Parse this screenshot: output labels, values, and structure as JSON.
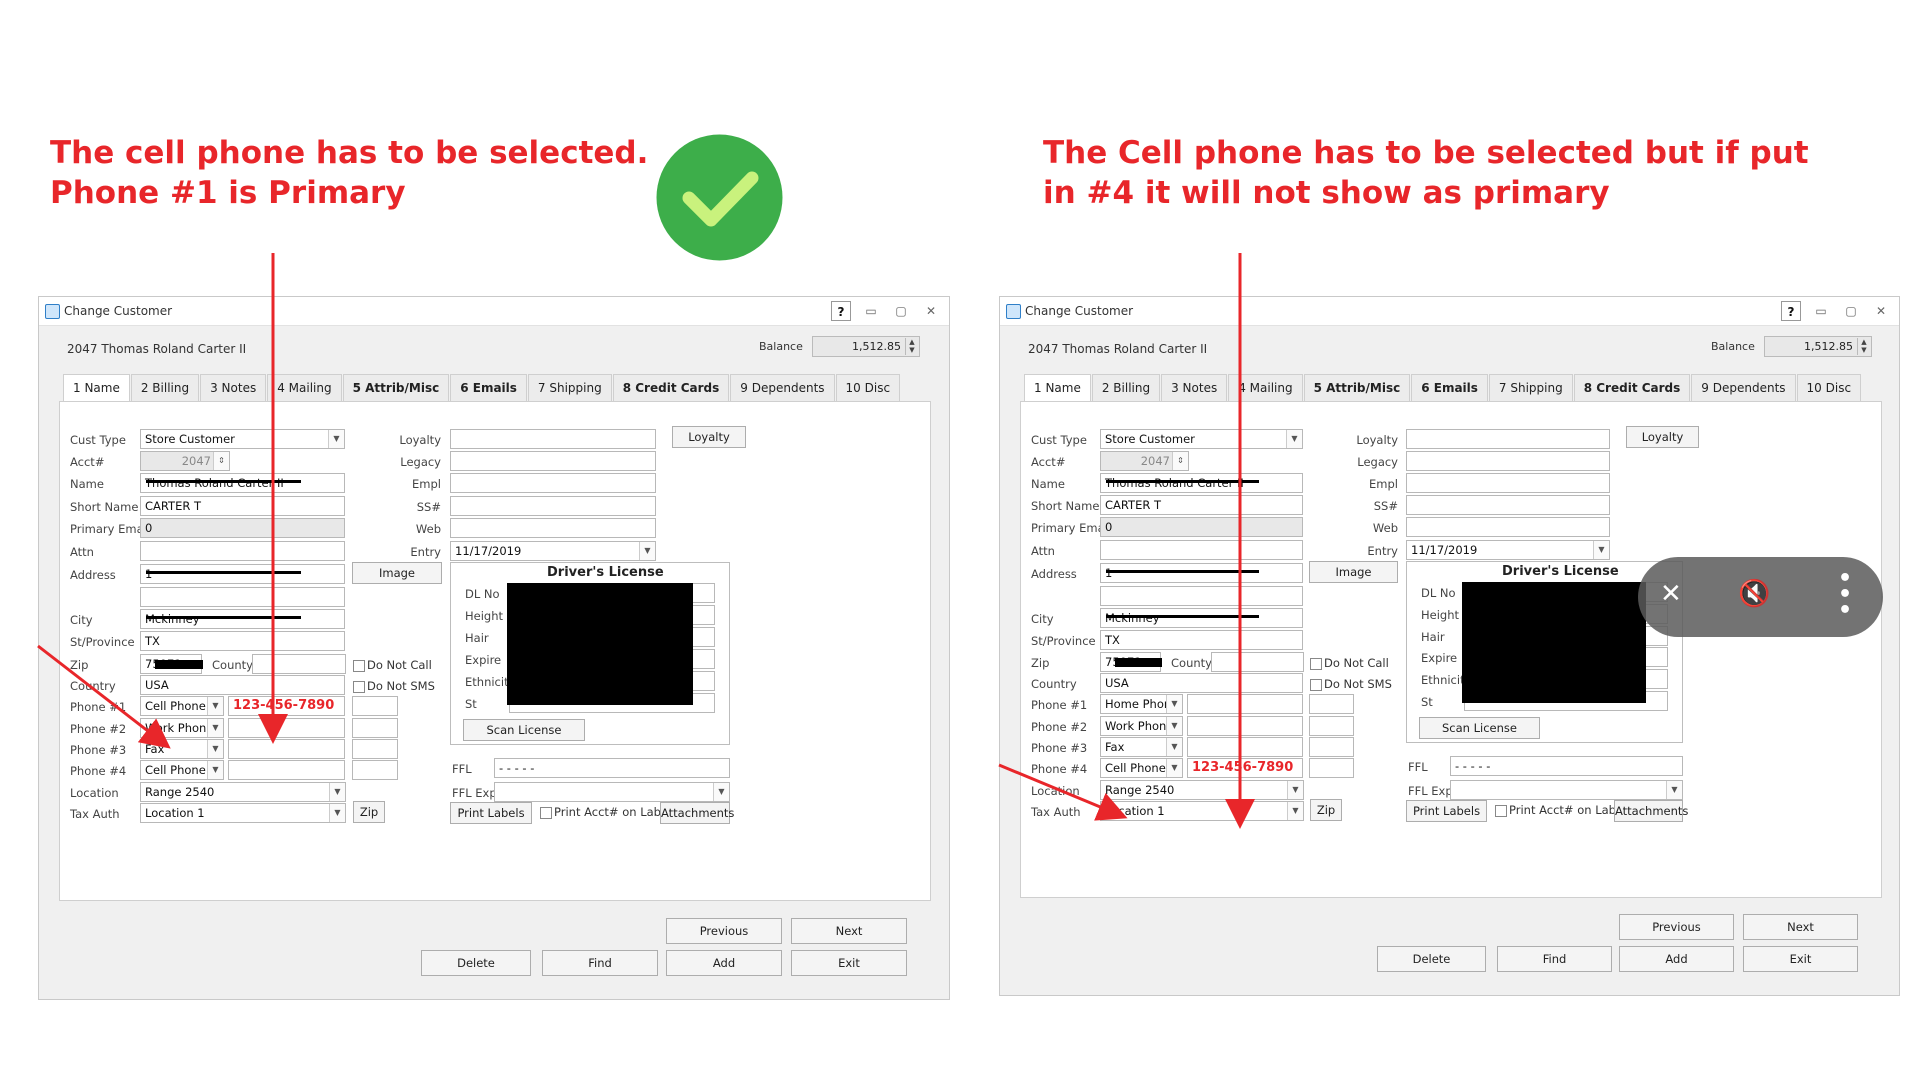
{
  "captions": {
    "left_line1": "The cell phone has to be selected.",
    "left_line2": "Phone #1 is Primary",
    "right_line1": "The Cell phone has to be selected but if put",
    "right_line2": "in #4 it will not show as primary"
  },
  "colors": {
    "annotation_red": "#e8262a",
    "check_green": "#3dae4a",
    "check_mark": "#c9f27d"
  },
  "icons": {
    "check": "check-circle-icon",
    "help": "help-icon",
    "minimize": "minimize-icon",
    "maximize": "maximize-icon",
    "close": "close-icon"
  },
  "windows": [
    {
      "title": "Change Customer",
      "customer_name": "2047 Thomas Roland Carter II",
      "balance_label": "Balance",
      "balance_value": "1,512.85",
      "tabs": [
        "1 Name",
        "2 Billing",
        "3 Notes",
        "4 Mailing",
        "5 Attrib/Misc",
        "6 Emails",
        "7 Shipping",
        "8 Credit Cards",
        "9 Dependents",
        "10 Disc"
      ],
      "labels": {
        "cust_type": "Cust Type",
        "acct": "Acct#",
        "name": "Name",
        "short_name": "Short Name",
        "primary_email": "Primary Email",
        "attn": "Attn",
        "address": "Address",
        "city": "City",
        "st_province": "St/Province",
        "zip": "Zip",
        "county": "County",
        "country": "Country",
        "phone1": "Phone #1",
        "phone2": "Phone #2",
        "phone3": "Phone #3",
        "phone4": "Phone #4",
        "location": "Location",
        "tax_auth": "Tax Auth",
        "loyalty": "Loyalty",
        "legacy": "Legacy",
        "empl": "Empl",
        "ss": "SS#",
        "web": "Web",
        "entry": "Entry",
        "ffl": "FFL",
        "ffl_exp": "FFL Exp"
      },
      "values": {
        "cust_type": "Store Customer",
        "acct": "2047",
        "name": "Thomas Roland Carter II",
        "short_name": "CARTER T",
        "primary_email": "0",
        "attn": "",
        "address": "1",
        "city": "Mckinney",
        "st_province": "TX",
        "zip": "75071",
        "country": "USA",
        "phone1_type": "Cell Phone",
        "phone1_number": "123-456-7890",
        "phone2_type": "Work Phone",
        "phone3_type": "Fax",
        "phone4_type": "Cell Phone",
        "phone4_number": "",
        "location": "Range 2540",
        "tax_auth": "Location 1",
        "entry": "11/17/2019",
        "ffl": "- - - - -"
      },
      "drivers_license": {
        "title": "Driver's License",
        "fields": [
          "DL No",
          "Height",
          "Hair",
          "Expire",
          "Ethnicity",
          "St"
        ],
        "scan_label": "Scan License"
      },
      "buttons": {
        "loyalty": "Loyalty",
        "image": "Image",
        "zip": "Zip",
        "print_labels": "Print Labels",
        "attachments": "Attachments",
        "previous": "Previous",
        "next": "Next",
        "delete": "Delete",
        "find": "Find",
        "add": "Add",
        "exit": "Exit"
      },
      "checkboxes": {
        "do_not_call": "Do Not Call",
        "do_not_sms": "Do Not SMS",
        "print_acct": "Print Acct# on Label"
      }
    },
    {
      "title": "Change Customer",
      "customer_name": "2047 Thomas Roland Carter II",
      "balance_label": "Balance",
      "balance_value": "1,512.85",
      "tabs": [
        "1 Name",
        "2 Billing",
        "3 Notes",
        "4 Mailing",
        "5 Attrib/Misc",
        "6 Emails",
        "7 Shipping",
        "8 Credit Cards",
        "9 Dependents",
        "10 Disc"
      ],
      "labels": {
        "cust_type": "Cust Type",
        "acct": "Acct#",
        "name": "Name",
        "short_name": "Short Name",
        "primary_email": "Primary Email",
        "attn": "Attn",
        "address": "Address",
        "city": "City",
        "st_province": "St/Province",
        "zip": "Zip",
        "county": "County",
        "country": "Country",
        "phone1": "Phone #1",
        "phone2": "Phone #2",
        "phone3": "Phone #3",
        "phone4": "Phone #4",
        "location": "Location",
        "tax_auth": "Tax Auth",
        "loyalty": "Loyalty",
        "legacy": "Legacy",
        "empl": "Empl",
        "ss": "SS#",
        "web": "Web",
        "entry": "Entry",
        "ffl": "FFL",
        "ffl_exp": "FFL Exp"
      },
      "values": {
        "cust_type": "Store Customer",
        "acct": "2047",
        "name": "Thomas Roland Carter II",
        "short_name": "CARTER T",
        "primary_email": "0",
        "attn": "",
        "address": "1",
        "city": "Mckinney",
        "st_province": "TX",
        "zip": "75071",
        "country": "USA",
        "phone1_type": "Home Phone",
        "phone1_number": "",
        "phone2_type": "Work Phone",
        "phone3_type": "Fax",
        "phone4_type": "Cell Phone",
        "phone4_number": "123-456-7890",
        "location": "Range 2540",
        "tax_auth": "Location 1",
        "entry": "11/17/2019",
        "ffl": "- - - - -"
      },
      "drivers_license": {
        "title": "Driver's License",
        "fields": [
          "DL No",
          "Height",
          "Hair",
          "Expire",
          "Ethnicity",
          "St"
        ],
        "scan_label": "Scan License"
      },
      "buttons": {
        "loyalty": "Loyalty",
        "image": "Image",
        "zip": "Zip",
        "print_labels": "Print Labels",
        "attachments": "Attachments",
        "previous": "Previous",
        "next": "Next",
        "delete": "Delete",
        "find": "Find",
        "add": "Add",
        "exit": "Exit"
      },
      "checkboxes": {
        "do_not_call": "Do Not Call",
        "do_not_sms": "Do Not SMS",
        "print_acct": "Print Acct# on Label"
      }
    }
  ]
}
